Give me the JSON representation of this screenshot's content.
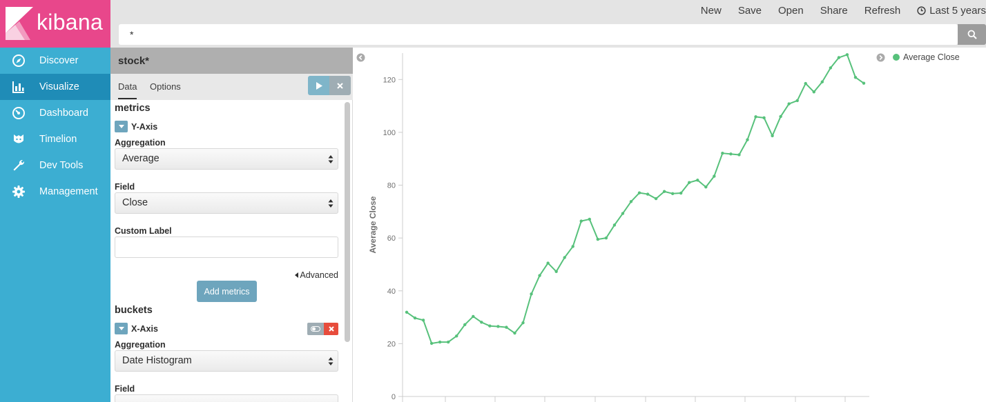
{
  "brand": {
    "name": "kibana",
    "accent": "#e8478b",
    "sidebar_color": "#3caed2",
    "sidebar_active_color": "#1f8cb7"
  },
  "sidebar": {
    "items": [
      {
        "label": "Discover",
        "icon": "compass-icon",
        "active": false
      },
      {
        "label": "Visualize",
        "icon": "bar-chart-icon",
        "active": true
      },
      {
        "label": "Dashboard",
        "icon": "gauge-icon",
        "active": false
      },
      {
        "label": "Timelion",
        "icon": "timelion-icon",
        "active": false
      },
      {
        "label": "Dev Tools",
        "icon": "wrench-icon",
        "active": false
      },
      {
        "label": "Management",
        "icon": "gear-icon",
        "active": false
      }
    ]
  },
  "topbar": {
    "links": [
      "New",
      "Save",
      "Open",
      "Share",
      "Refresh"
    ],
    "time_range": "Last 5 years"
  },
  "search": {
    "query": "*"
  },
  "editor": {
    "index_pattern": "stock*",
    "tabs": {
      "data": "Data",
      "options": "Options"
    },
    "metrics": {
      "section_title": "metrics",
      "agg_title": "Y-Axis",
      "aggregation_label": "Aggregation",
      "aggregation_value": "Average",
      "field_label": "Field",
      "field_value": "Close",
      "custom_label_label": "Custom Label",
      "custom_label_value": "",
      "advanced_link": "Advanced",
      "add_button": "Add metrics"
    },
    "buckets": {
      "section_title": "buckets",
      "agg_title": "X-Axis",
      "aggregation_label": "Aggregation",
      "aggregation_value": "Date Histogram",
      "field_label": "Field"
    }
  },
  "chart_data": {
    "type": "line",
    "ylabel": "Average Close",
    "xlabel": "",
    "ylim": [
      0,
      130
    ],
    "yticks": [
      0,
      20,
      40,
      60,
      80,
      100,
      120
    ],
    "grid": false,
    "legend_position": "top-right",
    "series": [
      {
        "name": "Average Close",
        "color": "#57c17b",
        "values": [
          31.9,
          29.7,
          28.9,
          20.1,
          20.6,
          20.6,
          22.9,
          27.2,
          30.3,
          28.1,
          26.7,
          26.5,
          26.2,
          24.0,
          27.9,
          38.8,
          45.8,
          50.5,
          47.3,
          52.6,
          56.8,
          66.4,
          67.1,
          59.5,
          60.0,
          64.9,
          69.3,
          73.8,
          77.1,
          76.6,
          74.9,
          77.6,
          76.8,
          77.0,
          81.0,
          81.9,
          79.3,
          83.4,
          92.1,
          91.8,
          91.5,
          97.2,
          105.9,
          105.5,
          98.7,
          106.0,
          110.8,
          112.0,
          118.5,
          115.3,
          119.1,
          124.4,
          128.3,
          129.4,
          120.8,
          118.6
        ]
      }
    ]
  }
}
